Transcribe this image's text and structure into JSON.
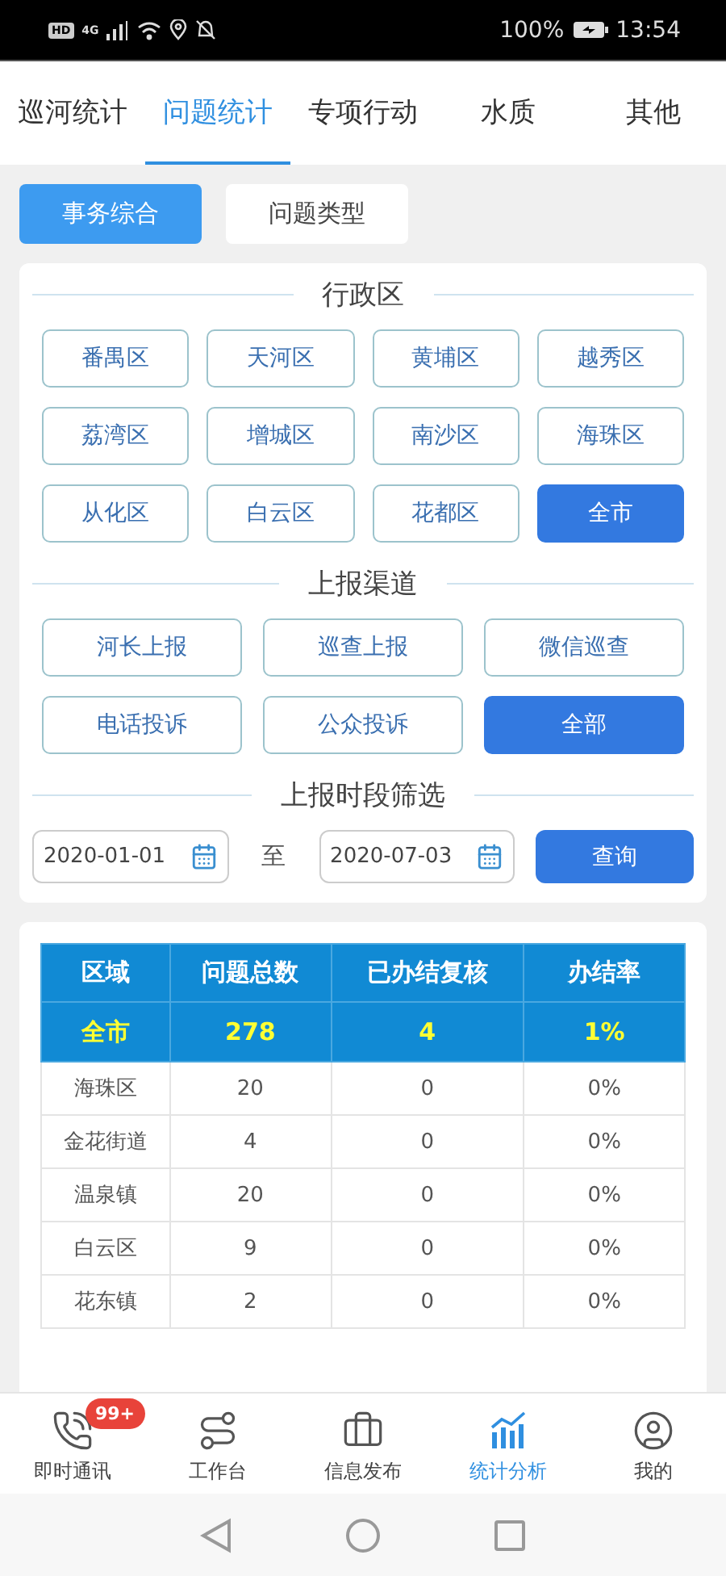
{
  "status_bar": {
    "hd": "HD",
    "network": "4G",
    "battery": "100%",
    "time": "13:54"
  },
  "tabs": [
    {
      "label": "巡河统计",
      "selected": false
    },
    {
      "label": "问题统计",
      "selected": true
    },
    {
      "label": "专项行动",
      "selected": false
    },
    {
      "label": "水质",
      "selected": false
    },
    {
      "label": "其他",
      "selected": false
    }
  ],
  "sub_tabs": [
    {
      "label": "事务综合",
      "selected": true
    },
    {
      "label": "问题类型",
      "selected": false
    }
  ],
  "filters": [
    {
      "title": "行政区",
      "options": [
        {
          "label": "番禺区",
          "selected": false
        },
        {
          "label": "天河区",
          "selected": false
        },
        {
          "label": "黄埔区",
          "selected": false
        },
        {
          "label": "越秀区",
          "selected": false
        },
        {
          "label": "荔湾区",
          "selected": false
        },
        {
          "label": "增城区",
          "selected": false
        },
        {
          "label": "南沙区",
          "selected": false
        },
        {
          "label": "海珠区",
          "selected": false
        },
        {
          "label": "从化区",
          "selected": false
        },
        {
          "label": "白云区",
          "selected": false
        },
        {
          "label": "花都区",
          "selected": false
        },
        {
          "label": "全市",
          "selected": true
        }
      ]
    },
    {
      "title": "上报渠道",
      "options": [
        {
          "label": "河长上报",
          "selected": false
        },
        {
          "label": "巡查上报",
          "selected": false
        },
        {
          "label": "微信巡查",
          "selected": false
        },
        {
          "label": "电话投诉",
          "selected": false
        },
        {
          "label": "公众投诉",
          "selected": false
        },
        {
          "label": "全部",
          "selected": true
        }
      ]
    }
  ],
  "period": {
    "title": "上报时段筛选",
    "start": "2020-01-01",
    "separator": "至",
    "end": "2020-07-03",
    "button": "查询"
  },
  "table": {
    "columns": [
      "区域",
      "问题总数",
      "已办结复核",
      "办结率"
    ],
    "total": [
      "全市",
      "278",
      "4",
      "1%"
    ],
    "rows": [
      [
        "海珠区",
        "20",
        "0",
        "0%"
      ],
      [
        "金花街道",
        "4",
        "0",
        "0%"
      ],
      [
        "温泉镇",
        "20",
        "0",
        "0%"
      ],
      [
        "白云区",
        "9",
        "0",
        "0%"
      ],
      [
        "花东镇",
        "2",
        "0",
        "0%"
      ]
    ]
  },
  "bottom_nav": [
    {
      "label": "即时通讯",
      "selected": false,
      "badge": "99+"
    },
    {
      "label": "工作台",
      "selected": false
    },
    {
      "label": "信息发布",
      "selected": false
    },
    {
      "label": "统计分析",
      "selected": true
    },
    {
      "label": "我的",
      "selected": false
    }
  ]
}
